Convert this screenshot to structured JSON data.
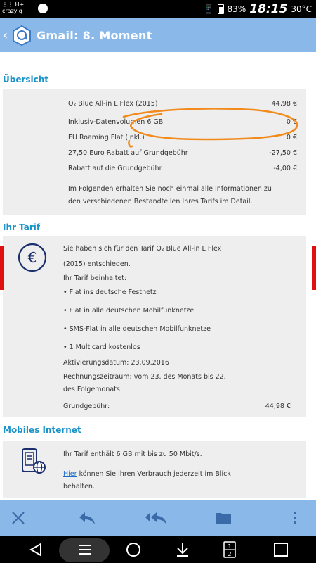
{
  "status": {
    "network": "H+",
    "carrier": "crazyiq",
    "battery": "83%",
    "time": "18:15",
    "temp": "30°C"
  },
  "app": {
    "title": "Gmail: 8. Moment"
  },
  "overview": {
    "title": "Übersicht",
    "items": [
      {
        "label": "O₂ Blue All-in L Flex (2015)",
        "value": "44,98 €"
      },
      {
        "label": "Inklusiv-Datenvolumen 6 GB",
        "value": "0 €"
      },
      {
        "label": "EU Roaming Flat (inkl.)",
        "value": "0 €"
      },
      {
        "label": "27,50 Euro Rabatt auf Grundgebühr",
        "value": "-27,50 €"
      },
      {
        "label": "Rabatt auf die Grundgebühr",
        "value": "-4,00 €"
      }
    ],
    "note_line1": "Im Folgenden erhalten Sie noch einmal alle Informationen zu",
    "note_line2": "den verschiedenen Bestandteilen Ihres Tarifs im Detail."
  },
  "tarif": {
    "title": "Ihr Tarif",
    "intro_line1": "Sie haben sich für den Tarif O₂ Blue All-in L Flex",
    "intro_line2": "(2015) entschieden.",
    "includes": "Ihr Tarif beinhaltet:",
    "features": [
      "• Flat ins deutsche Festnetz",
      "• Flat in alle deutschen Mobilfunknetze",
      "• SMS-Flat in alle deutschen Mobilfunknetze",
      "• 1 Multicard kostenlos"
    ],
    "activation": "Aktivierungsdatum: 23.09.2016",
    "billing_line1": "Rechnungszeitraum: vom 23. des Monats bis 22.",
    "billing_line2": "des Folgemonats",
    "fee_label": "Grundgebühr:",
    "fee_value": "44,98 €"
  },
  "mobile": {
    "title": "Mobiles Internet",
    "line1": "Ihr Tarif enthält 6 GB mit bis zu 50 Mbit/s.",
    "link": "Hier",
    "line2_rest": " können Sie Ihren Verbrauch jederzeit im Blick",
    "line3": "behalten."
  },
  "nav": {
    "page_indicator_top": "1",
    "page_indicator_bottom": "2"
  },
  "colors": {
    "accent": "#8ab8e8",
    "section_title": "#1b93c9",
    "marker": "#e01010"
  }
}
